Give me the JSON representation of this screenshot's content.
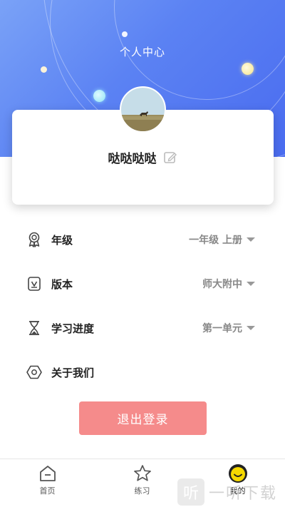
{
  "header": {
    "title": "个人中心"
  },
  "profile": {
    "username": "哒哒哒哒"
  },
  "menu": {
    "items": [
      {
        "label": "年级",
        "value": "一年级 上册",
        "icon": "medal-icon",
        "has_caret": true
      },
      {
        "label": "版本",
        "value": "师大附中",
        "icon": "version-icon",
        "has_caret": true
      },
      {
        "label": "学习进度",
        "value": "第一单元",
        "icon": "hourglass-icon",
        "has_caret": true
      },
      {
        "label": "关于我们",
        "value": "",
        "icon": "hexagon-icon",
        "has_caret": false
      }
    ]
  },
  "logout": {
    "label": "退出登录"
  },
  "tabbar": {
    "tabs": [
      {
        "label": "首页",
        "icon": "home-icon",
        "active": false
      },
      {
        "label": "练习",
        "icon": "star-icon",
        "active": false
      },
      {
        "label": "我的",
        "icon": "smiley-icon",
        "active": true
      }
    ]
  },
  "watermark": {
    "logo": "听",
    "text": "一听下载"
  },
  "colors": {
    "header_gradient_start": "#7aa2f7",
    "header_gradient_end": "#4a6cf0",
    "logout_button": "#f58b8b",
    "active_tab_icon": "#f5d800"
  }
}
